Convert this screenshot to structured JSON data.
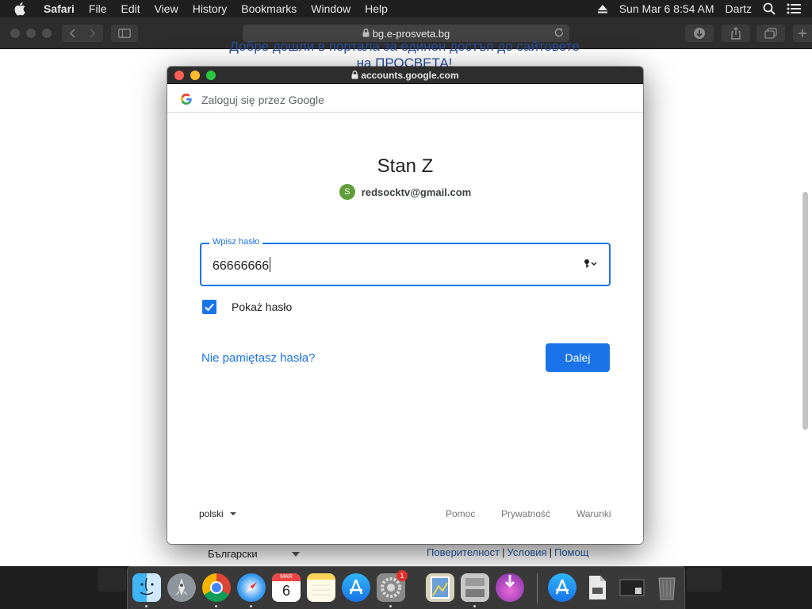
{
  "menubar": {
    "app": "Safari",
    "menus": [
      "File",
      "Edit",
      "View",
      "History",
      "Bookmarks",
      "Window",
      "Help"
    ],
    "clock": "Sun Mar 6  8:54 AM",
    "user": "Dartz"
  },
  "safari": {
    "url": "bg.e-prosveta.bg"
  },
  "background_page": {
    "heading_line1": "Добре дошли в портала за единен достъп до сайтовете",
    "heading_line2": "на ПРОСВЕТА!",
    "language": "Български",
    "links": [
      "Поверителност",
      "Условия",
      "Помощ"
    ]
  },
  "popup": {
    "url": "accounts.google.com",
    "header_text": "Zaloguj się przez Google",
    "user_name": "Stan Z",
    "avatar_letter": "S",
    "email": "redsocktv@gmail.com",
    "password_label": "Wpisz hasło",
    "password_value": "66666666",
    "show_password_label": "Pokaż hasło",
    "show_password_checked": true,
    "forgot_link": "Nie pamiętasz hasła?",
    "next_button": "Dalej",
    "language": "polski",
    "footer_links": [
      "Pomoc",
      "Prywatność",
      "Warunki"
    ]
  },
  "dock": {
    "calendar_month": "MAR",
    "calendar_day": "6",
    "settings_badge": "1",
    "icons": [
      "finder-icon",
      "launchpad-icon",
      "chrome-icon",
      "safari-icon",
      "calendar-icon",
      "notes-icon",
      "app-store-icon",
      "system-preferences-icon",
      "preview-icon",
      "utility-icon",
      "installer-icon",
      "app-store-download-icon",
      "file-icon",
      "screenshot-icon",
      "trash-icon"
    ]
  },
  "colors": {
    "google_blue": "#1a73e8",
    "avatar_green": "#5f9e3a",
    "close_red": "#ff5f57",
    "minimize_yellow": "#febc2e",
    "zoom_green": "#28c840"
  }
}
